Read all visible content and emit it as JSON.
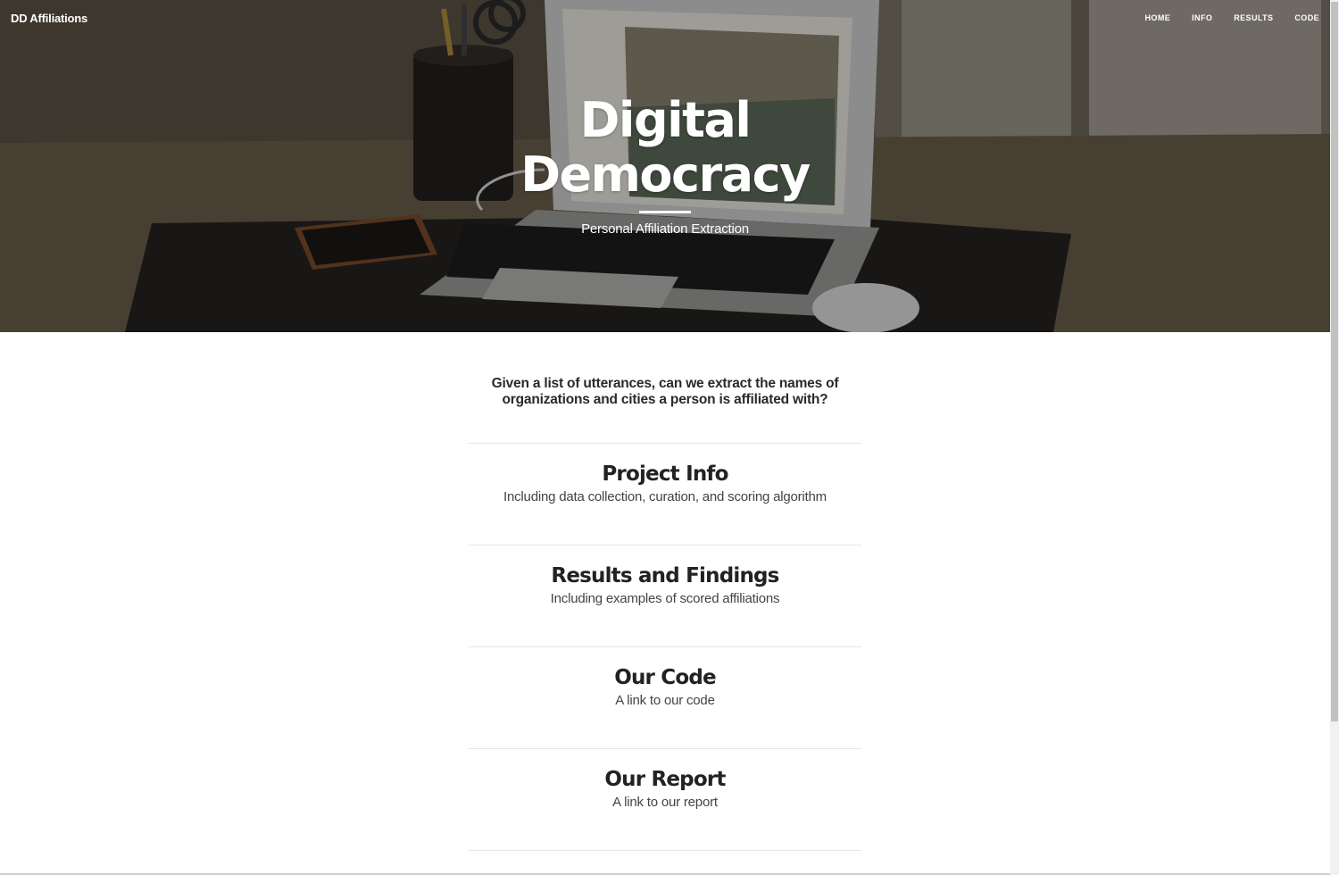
{
  "nav": {
    "brand": "DD Affiliations",
    "links": [
      {
        "label": "HOME"
      },
      {
        "label": "INFO"
      },
      {
        "label": "RESULTS"
      },
      {
        "label": "CODE"
      }
    ]
  },
  "hero": {
    "title": "Digital Democracy",
    "subtitle": "Personal Affiliation Extraction"
  },
  "main": {
    "lead": "Given a list of utterances, can we extract the names of organizations and cities a person is affiliated with?",
    "sections": [
      {
        "title": "Project Info",
        "subtitle": "Including data collection, curation, and scoring algorithm"
      },
      {
        "title": "Results and Findings",
        "subtitle": "Including examples of scored affiliations"
      },
      {
        "title": "Our Code",
        "subtitle": "A link to our code"
      },
      {
        "title": "Our Report",
        "subtitle": "A link to our report"
      }
    ]
  },
  "colors": {
    "hero_overlay": "#000000",
    "text_dark": "#222222",
    "text_muted": "#444444",
    "divider": "#e6e6e6"
  },
  "icons": {
    "hero_background": "desk-laptop-photo"
  }
}
